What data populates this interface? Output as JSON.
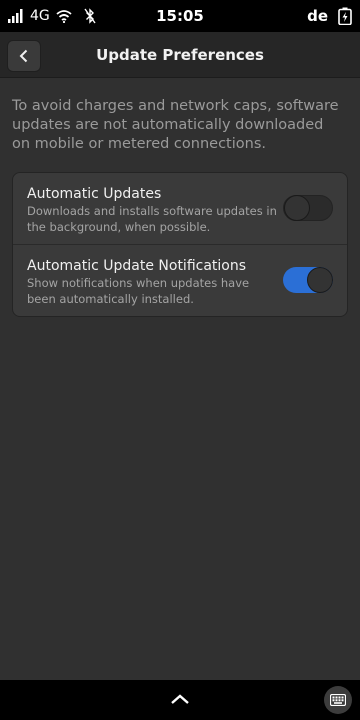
{
  "status_bar": {
    "network": "4G",
    "time": "15:05",
    "language": "de",
    "icons": [
      "signal-icon",
      "wifi-icon",
      "bluetooth-disabled-icon",
      "battery-charging-icon"
    ]
  },
  "header": {
    "title": "Update Preferences",
    "back_icon": "chevron-left-icon"
  },
  "description": "To avoid charges and network caps, software updates are not automatically downloaded on mobile or metered connections.",
  "settings": [
    {
      "title": "Automatic Updates",
      "subtitle": "Downloads and installs software updates in the background, when possible.",
      "enabled": false
    },
    {
      "title": "Automatic Update Notifications",
      "subtitle": "Show notifications when updates have been automatically installed.",
      "enabled": true
    }
  ],
  "bottom_bar": {
    "icons": [
      "chevron-up-icon",
      "keyboard-icon"
    ]
  },
  "colors": {
    "accent": "#2b6fd6",
    "background": "#303030",
    "card": "#3a3a3a"
  }
}
